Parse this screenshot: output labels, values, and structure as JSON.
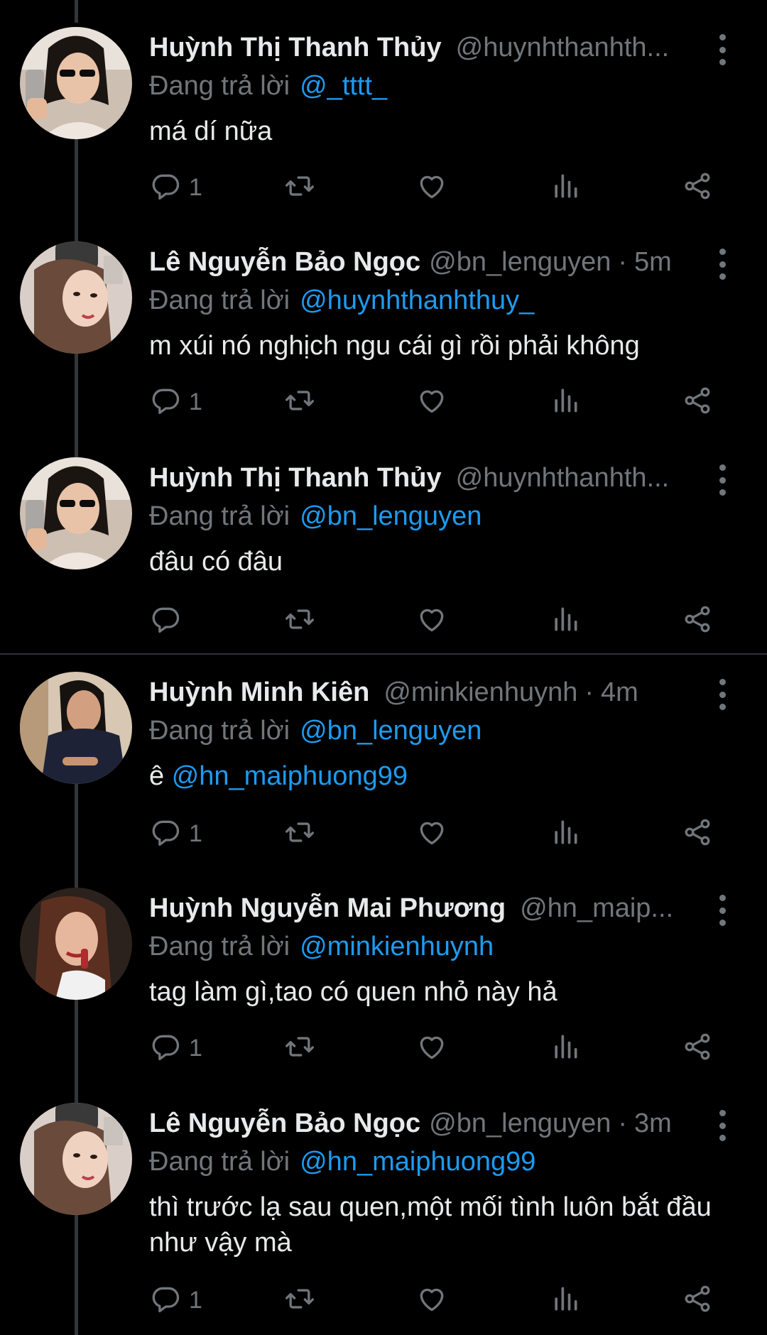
{
  "colors": {
    "background": "#000000",
    "text_primary": "#e7e9ea",
    "text_secondary": "#71767b",
    "link": "#1d9bf0",
    "thread_line": "#333639"
  },
  "replying_prefix": "Đang trả lời",
  "icons": {
    "reply": "reply-icon",
    "retweet": "retweet-icon",
    "like": "heart-icon",
    "views": "views-bar-icon",
    "share": "share-icon",
    "more": "more-vertical-icon"
  },
  "tweets": [
    {
      "name": "Huỳnh Thị Thanh Thủy",
      "handle": "@huynhthanhth...",
      "time": "",
      "replying_to": "@_tttt_",
      "text": "má dí nữa",
      "reply_count": "1",
      "avatar": "photo-woman-sunglasses"
    },
    {
      "name": "Lê Nguyễn Bảo Ngọc",
      "handle": "@bn_lenguyen",
      "time": "5m",
      "replying_to": "@huynhthanhthuy_",
      "text": "m xúi nó nghịch ngu cái gì rồi phải không",
      "reply_count": "1",
      "avatar": "photo-woman-selfie"
    },
    {
      "name": "Huỳnh Thị Thanh Thủy",
      "handle": "@huynhthanhth...",
      "time": "",
      "replying_to": "@bn_lenguyen",
      "text": "đâu có đâu",
      "reply_count": "",
      "avatar": "photo-woman-sunglasses"
    },
    {
      "name": "Huỳnh Minh Kiên",
      "handle": "@minkienhuynh",
      "time": "4m",
      "replying_to": "@bn_lenguyen",
      "text_prefix": "ê ",
      "text_mention": "@hn_maiphuong99",
      "reply_count": "1",
      "avatar": "photo-person-dark-shirt"
    },
    {
      "name": "Huỳnh Nguyễn Mai Phương",
      "handle": "@hn_maip...",
      "time": "",
      "replying_to": "@minkienhuynh",
      "text": "tag làm gì,tao có quen nhỏ này hả",
      "reply_count": "1",
      "avatar": "photo-woman-lipstick"
    },
    {
      "name": "Lê Nguyễn Bảo Ngọc",
      "handle": "@bn_lenguyen",
      "time": "3m",
      "replying_to": "@hn_maiphuong99",
      "text": "thì trước lạ sau quen,một mối tình luôn bắt đầu như vậy mà",
      "reply_count": "1",
      "avatar": "photo-woman-selfie"
    }
  ]
}
